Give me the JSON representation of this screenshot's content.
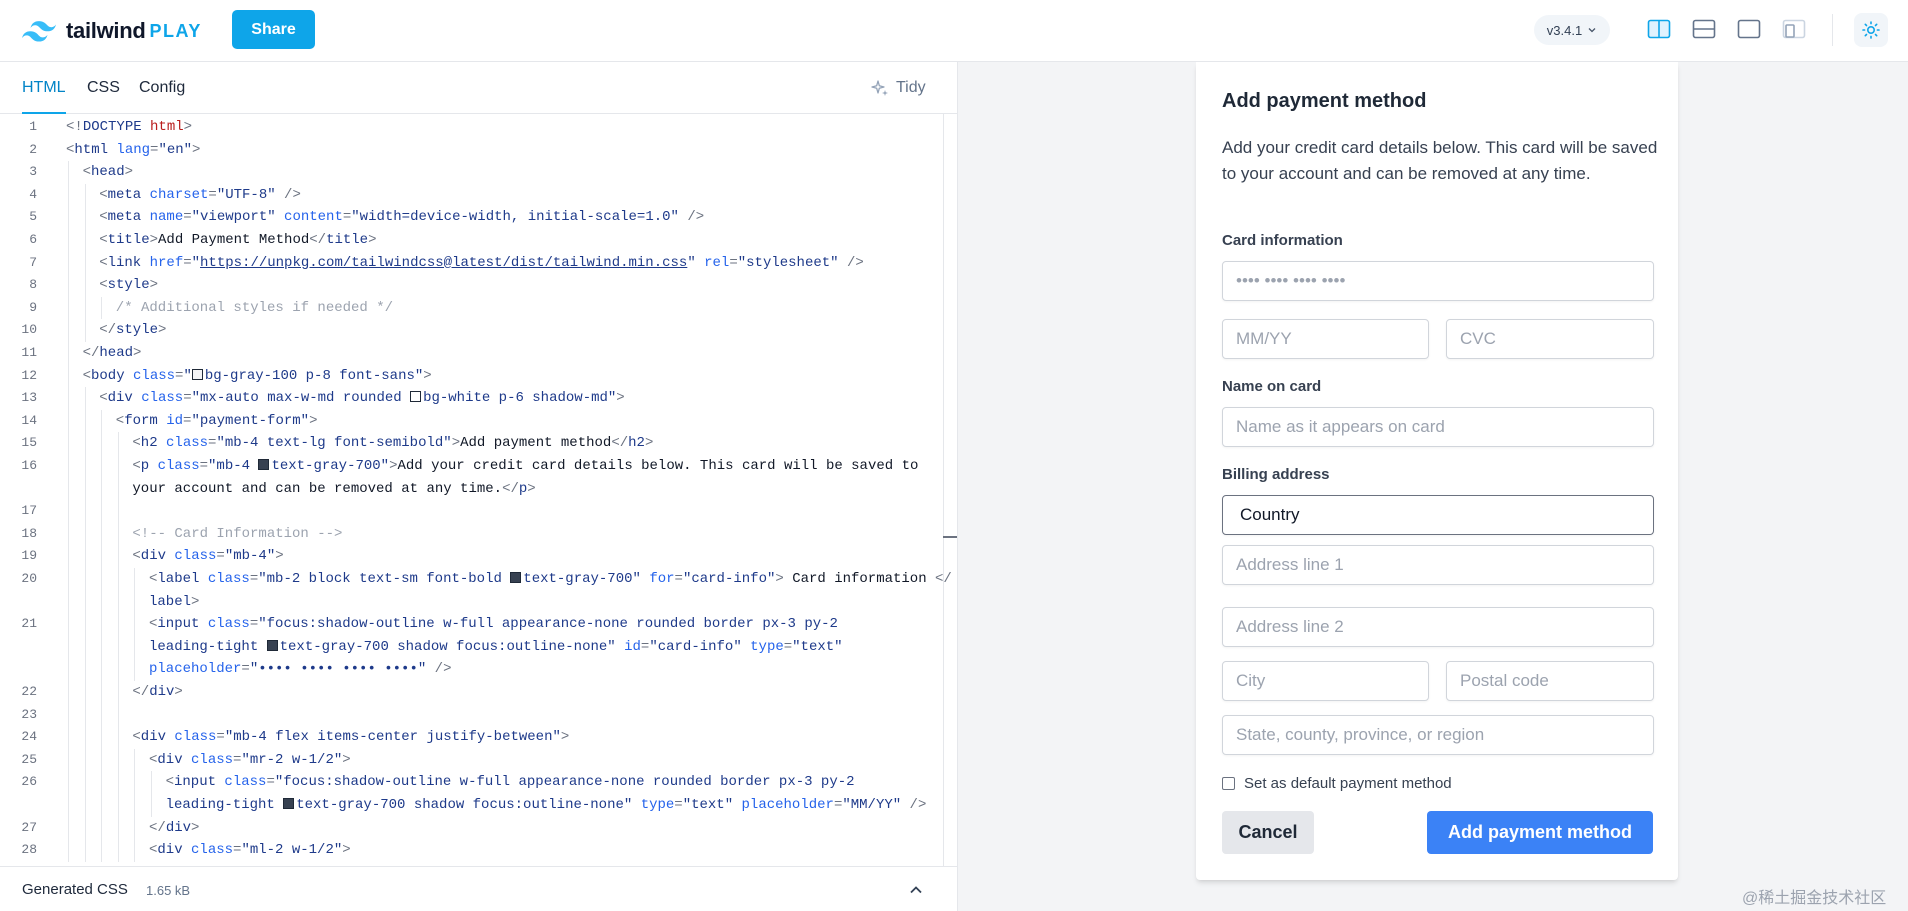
{
  "topbar": {
    "logo_text": "tailwind",
    "logo_play": "PLAY",
    "share_label": "Share",
    "version": "v3.4.1",
    "layout_icons": [
      "split-vertical-icon",
      "split-horizontal-icon",
      "preview-only-icon",
      "responsive-icon"
    ],
    "theme_icon": "sun-icon"
  },
  "editor": {
    "tabs": [
      {
        "label": "HTML",
        "active": true
      },
      {
        "label": "CSS",
        "active": false
      },
      {
        "label": "Config",
        "active": false
      }
    ],
    "tidy_label": "Tidy",
    "generated_css_label": "Generated CSS",
    "generated_css_size": "1.65 kB"
  },
  "preview": {
    "title": "Add payment method",
    "description": "Add your credit card details below. This card will be saved to your account and can be removed at any time.",
    "card_info_label": "Card information",
    "card_number_placeholder": "•••• •••• •••• ••••",
    "expiry_placeholder": "MM/YY",
    "cvc_placeholder": "CVC",
    "name_label": "Name on card",
    "name_placeholder": "Name as it appears on card",
    "billing_label": "Billing address",
    "country_value": "Country",
    "address1_placeholder": "Address line 1",
    "address2_placeholder": "Address line 2",
    "city_placeholder": "City",
    "postal_placeholder": "Postal code",
    "state_placeholder": "State, county, province, or region",
    "default_checkbox_label": "Set as default payment method",
    "cancel_label": "Cancel",
    "submit_label": "Add payment method"
  },
  "watermark": "@稀土掘金技术社区",
  "colors": {
    "accent": "#0ea5e9",
    "submit": "#3b82f6",
    "cancel_bg": "#e5e7eb"
  },
  "code_lines": [
    {
      "n": "1",
      "indent": 0,
      "tokens": [
        [
          "t-tag",
          "<!"
        ],
        [
          "t-name",
          "DOCTYPE "
        ],
        [
          "t-html",
          "html"
        ],
        [
          "t-tag",
          ">"
        ]
      ]
    },
    {
      "n": "2",
      "indent": 0,
      "tokens": [
        [
          "t-tag",
          "<"
        ],
        [
          "t-name",
          "html "
        ],
        [
          "t-attr",
          "lang"
        ],
        [
          "t-tag",
          "="
        ],
        [
          "t-str",
          "\"en\""
        ],
        [
          "t-tag",
          ">"
        ]
      ]
    },
    {
      "n": "3",
      "indent": 1,
      "tokens": [
        [
          "t-tag",
          "<"
        ],
        [
          "t-name",
          "head"
        ],
        [
          "t-tag",
          ">"
        ]
      ]
    },
    {
      "n": "4",
      "indent": 2,
      "tokens": [
        [
          "t-tag",
          "<"
        ],
        [
          "t-name",
          "meta "
        ],
        [
          "t-attr",
          "charset"
        ],
        [
          "t-tag",
          "="
        ],
        [
          "t-str",
          "\"UTF-8\""
        ],
        [
          "t-tag",
          " />"
        ]
      ]
    },
    {
      "n": "5",
      "indent": 2,
      "tokens": [
        [
          "t-tag",
          "<"
        ],
        [
          "t-name",
          "meta "
        ],
        [
          "t-attr",
          "name"
        ],
        [
          "t-tag",
          "="
        ],
        [
          "t-str",
          "\"viewport\" "
        ],
        [
          "t-attr",
          "content"
        ],
        [
          "t-tag",
          "="
        ],
        [
          "t-str",
          "\"width=device-width, initial-scale=1.0\""
        ],
        [
          "t-tag",
          " />"
        ]
      ]
    },
    {
      "n": "6",
      "indent": 2,
      "tokens": [
        [
          "t-tag",
          "<"
        ],
        [
          "t-name",
          "title"
        ],
        [
          "t-tag",
          ">"
        ],
        [
          "t-txt",
          "Add Payment Method"
        ],
        [
          "t-tag",
          "</"
        ],
        [
          "t-name",
          "title"
        ],
        [
          "t-tag",
          ">"
        ]
      ]
    },
    {
      "n": "7",
      "indent": 2,
      "tokens": [
        [
          "t-tag",
          "<"
        ],
        [
          "t-name",
          "link "
        ],
        [
          "t-attr",
          "href"
        ],
        [
          "t-tag",
          "="
        ],
        [
          "t-str",
          "\""
        ],
        [
          "t-url",
          "https://unpkg.com/tailwindcss@latest/dist/tailwind.min.css"
        ],
        [
          "t-str",
          "\" "
        ],
        [
          "t-attr",
          "rel"
        ],
        [
          "t-tag",
          "="
        ],
        [
          "t-str",
          "\"stylesheet\""
        ],
        [
          "t-tag",
          " />"
        ]
      ]
    },
    {
      "n": "8",
      "indent": 2,
      "tokens": [
        [
          "t-tag",
          "<"
        ],
        [
          "t-name",
          "style"
        ],
        [
          "t-tag",
          ">"
        ]
      ]
    },
    {
      "n": "9",
      "indent": 3,
      "tokens": [
        [
          "t-cmt",
          "/* Additional styles if needed */"
        ]
      ]
    },
    {
      "n": "10",
      "indent": 2,
      "tokens": [
        [
          "t-tag",
          "</"
        ],
        [
          "t-name",
          "style"
        ],
        [
          "t-tag",
          ">"
        ]
      ]
    },
    {
      "n": "11",
      "indent": 1,
      "tokens": [
        [
          "t-tag",
          "</"
        ],
        [
          "t-name",
          "head"
        ],
        [
          "t-tag",
          ">"
        ]
      ]
    },
    {
      "n": "12",
      "indent": 1,
      "tokens": [
        [
          "t-tag",
          "<"
        ],
        [
          "t-name",
          "body "
        ],
        [
          "t-attr",
          "class"
        ],
        [
          "t-tag",
          "="
        ],
        [
          "t-str",
          "\""
        ],
        [
          "sw",
          "gray100"
        ],
        [
          "t-str",
          "bg-gray-100 p-8 font-sans\""
        ],
        [
          "t-tag",
          ">"
        ]
      ]
    },
    {
      "n": "13",
      "indent": 2,
      "tokens": [
        [
          "t-tag",
          "<"
        ],
        [
          "t-name",
          "div "
        ],
        [
          "t-attr",
          "class"
        ],
        [
          "t-tag",
          "="
        ],
        [
          "t-str",
          "\"mx-auto max-w-md rounded "
        ],
        [
          "sw",
          "white"
        ],
        [
          "t-str",
          "bg-white p-6 shadow-md\""
        ],
        [
          "t-tag",
          ">"
        ]
      ]
    },
    {
      "n": "14",
      "indent": 3,
      "tokens": [
        [
          "t-tag",
          "<"
        ],
        [
          "t-name",
          "form "
        ],
        [
          "t-attr",
          "id"
        ],
        [
          "t-tag",
          "="
        ],
        [
          "t-str",
          "\"payment-form\""
        ],
        [
          "t-tag",
          ">"
        ]
      ]
    },
    {
      "n": "15",
      "indent": 4,
      "tokens": [
        [
          "t-tag",
          "<"
        ],
        [
          "t-name",
          "h2 "
        ],
        [
          "t-attr",
          "class"
        ],
        [
          "t-tag",
          "="
        ],
        [
          "t-str",
          "\"mb-4 text-lg font-semibold\""
        ],
        [
          "t-tag",
          ">"
        ],
        [
          "t-txt",
          "Add payment method"
        ],
        [
          "t-tag",
          "</"
        ],
        [
          "t-name",
          "h2"
        ],
        [
          "t-tag",
          ">"
        ]
      ]
    },
    {
      "n": "16",
      "indent": 4,
      "tokens": [
        [
          "t-tag",
          "<"
        ],
        [
          "t-name",
          "p "
        ],
        [
          "t-attr",
          "class"
        ],
        [
          "t-tag",
          "="
        ],
        [
          "t-str",
          "\"mb-4 "
        ],
        [
          "sw",
          "gray700"
        ],
        [
          "t-str",
          "text-gray-700\""
        ],
        [
          "t-tag",
          ">"
        ],
        [
          "t-txt",
          "Add your credit card details below. This card will be saved to"
        ]
      ]
    },
    {
      "n": "",
      "indent": 4,
      "tokens": [
        [
          "t-txt",
          "your account and can be removed at any time."
        ],
        [
          "t-tag",
          "</"
        ],
        [
          "t-name",
          "p"
        ],
        [
          "t-tag",
          ">"
        ]
      ]
    },
    {
      "n": "17",
      "indent": 4,
      "tokens": []
    },
    {
      "n": "18",
      "indent": 4,
      "tokens": [
        [
          "t-cmt",
          "<!-- Card Information -->"
        ]
      ]
    },
    {
      "n": "19",
      "indent": 4,
      "tokens": [
        [
          "t-tag",
          "<"
        ],
        [
          "t-name",
          "div "
        ],
        [
          "t-attr",
          "class"
        ],
        [
          "t-tag",
          "="
        ],
        [
          "t-str",
          "\"mb-4\""
        ],
        [
          "t-tag",
          ">"
        ]
      ]
    },
    {
      "n": "20",
      "indent": 5,
      "tokens": [
        [
          "t-tag",
          "<"
        ],
        [
          "t-name",
          "label "
        ],
        [
          "t-attr",
          "class"
        ],
        [
          "t-tag",
          "="
        ],
        [
          "t-str",
          "\"mb-2 block text-sm font-bold "
        ],
        [
          "sw",
          "gray700"
        ],
        [
          "t-str",
          "text-gray-700\" "
        ],
        [
          "t-attr",
          "for"
        ],
        [
          "t-tag",
          "="
        ],
        [
          "t-str",
          "\"card-info\""
        ],
        [
          "t-tag",
          "> "
        ],
        [
          "t-txt",
          "Card information "
        ],
        [
          "t-tag",
          "</"
        ]
      ]
    },
    {
      "n": "",
      "indent": 5,
      "tokens": [
        [
          "t-name",
          "label"
        ],
        [
          "t-tag",
          ">"
        ]
      ]
    },
    {
      "n": "21",
      "indent": 5,
      "tokens": [
        [
          "t-tag",
          "<"
        ],
        [
          "t-name",
          "input "
        ],
        [
          "t-attr",
          "class"
        ],
        [
          "t-tag",
          "="
        ],
        [
          "t-str",
          "\"focus:shadow-outline w-full appearance-none rounded border px-3 py-2"
        ]
      ]
    },
    {
      "n": "",
      "indent": 5,
      "tokens": [
        [
          "t-str",
          "leading-tight "
        ],
        [
          "sw",
          "gray700"
        ],
        [
          "t-str",
          "text-gray-700 shadow focus:outline-none\" "
        ],
        [
          "t-attr",
          "id"
        ],
        [
          "t-tag",
          "="
        ],
        [
          "t-str",
          "\"card-info\" "
        ],
        [
          "t-attr",
          "type"
        ],
        [
          "t-tag",
          "="
        ],
        [
          "t-str",
          "\"text\""
        ]
      ]
    },
    {
      "n": "",
      "indent": 5,
      "tokens": [
        [
          "t-attr",
          "placeholder"
        ],
        [
          "t-tag",
          "="
        ],
        [
          "t-str",
          "\"•••• •••• •••• ••••\""
        ],
        [
          "t-tag",
          " />"
        ]
      ]
    },
    {
      "n": "22",
      "indent": 4,
      "tokens": [
        [
          "t-tag",
          "</"
        ],
        [
          "t-name",
          "div"
        ],
        [
          "t-tag",
          ">"
        ]
      ]
    },
    {
      "n": "23",
      "indent": 4,
      "tokens": []
    },
    {
      "n": "24",
      "indent": 4,
      "tokens": [
        [
          "t-tag",
          "<"
        ],
        [
          "t-name",
          "div "
        ],
        [
          "t-attr",
          "class"
        ],
        [
          "t-tag",
          "="
        ],
        [
          "t-str",
          "\"mb-4 flex items-center justify-between\""
        ],
        [
          "t-tag",
          ">"
        ]
      ]
    },
    {
      "n": "25",
      "indent": 5,
      "tokens": [
        [
          "t-tag",
          "<"
        ],
        [
          "t-name",
          "div "
        ],
        [
          "t-attr",
          "class"
        ],
        [
          "t-tag",
          "="
        ],
        [
          "t-str",
          "\"mr-2 w-1/2\""
        ],
        [
          "t-tag",
          ">"
        ]
      ]
    },
    {
      "n": "26",
      "indent": 6,
      "tokens": [
        [
          "t-tag",
          "<"
        ],
        [
          "t-name",
          "input "
        ],
        [
          "t-attr",
          "class"
        ],
        [
          "t-tag",
          "="
        ],
        [
          "t-str",
          "\"focus:shadow-outline w-full appearance-none rounded border px-3 py-2"
        ]
      ]
    },
    {
      "n": "",
      "indent": 6,
      "tokens": [
        [
          "t-str",
          "leading-tight "
        ],
        [
          "sw",
          "gray700"
        ],
        [
          "t-str",
          "text-gray-700 shadow focus:outline-none\" "
        ],
        [
          "t-attr",
          "type"
        ],
        [
          "t-tag",
          "="
        ],
        [
          "t-str",
          "\"text\" "
        ],
        [
          "t-attr",
          "placeholder"
        ],
        [
          "t-tag",
          "="
        ],
        [
          "t-str",
          "\"MM/YY\""
        ],
        [
          "t-tag",
          " />"
        ]
      ]
    },
    {
      "n": "27",
      "indent": 5,
      "tokens": [
        [
          "t-tag",
          "</"
        ],
        [
          "t-name",
          "div"
        ],
        [
          "t-tag",
          ">"
        ]
      ]
    },
    {
      "n": "28",
      "indent": 5,
      "tokens": [
        [
          "t-tag",
          "<"
        ],
        [
          "t-name",
          "div "
        ],
        [
          "t-attr",
          "class"
        ],
        [
          "t-tag",
          "="
        ],
        [
          "t-str",
          "\"ml-2 w-1/2\""
        ],
        [
          "t-tag",
          ">"
        ]
      ]
    }
  ]
}
